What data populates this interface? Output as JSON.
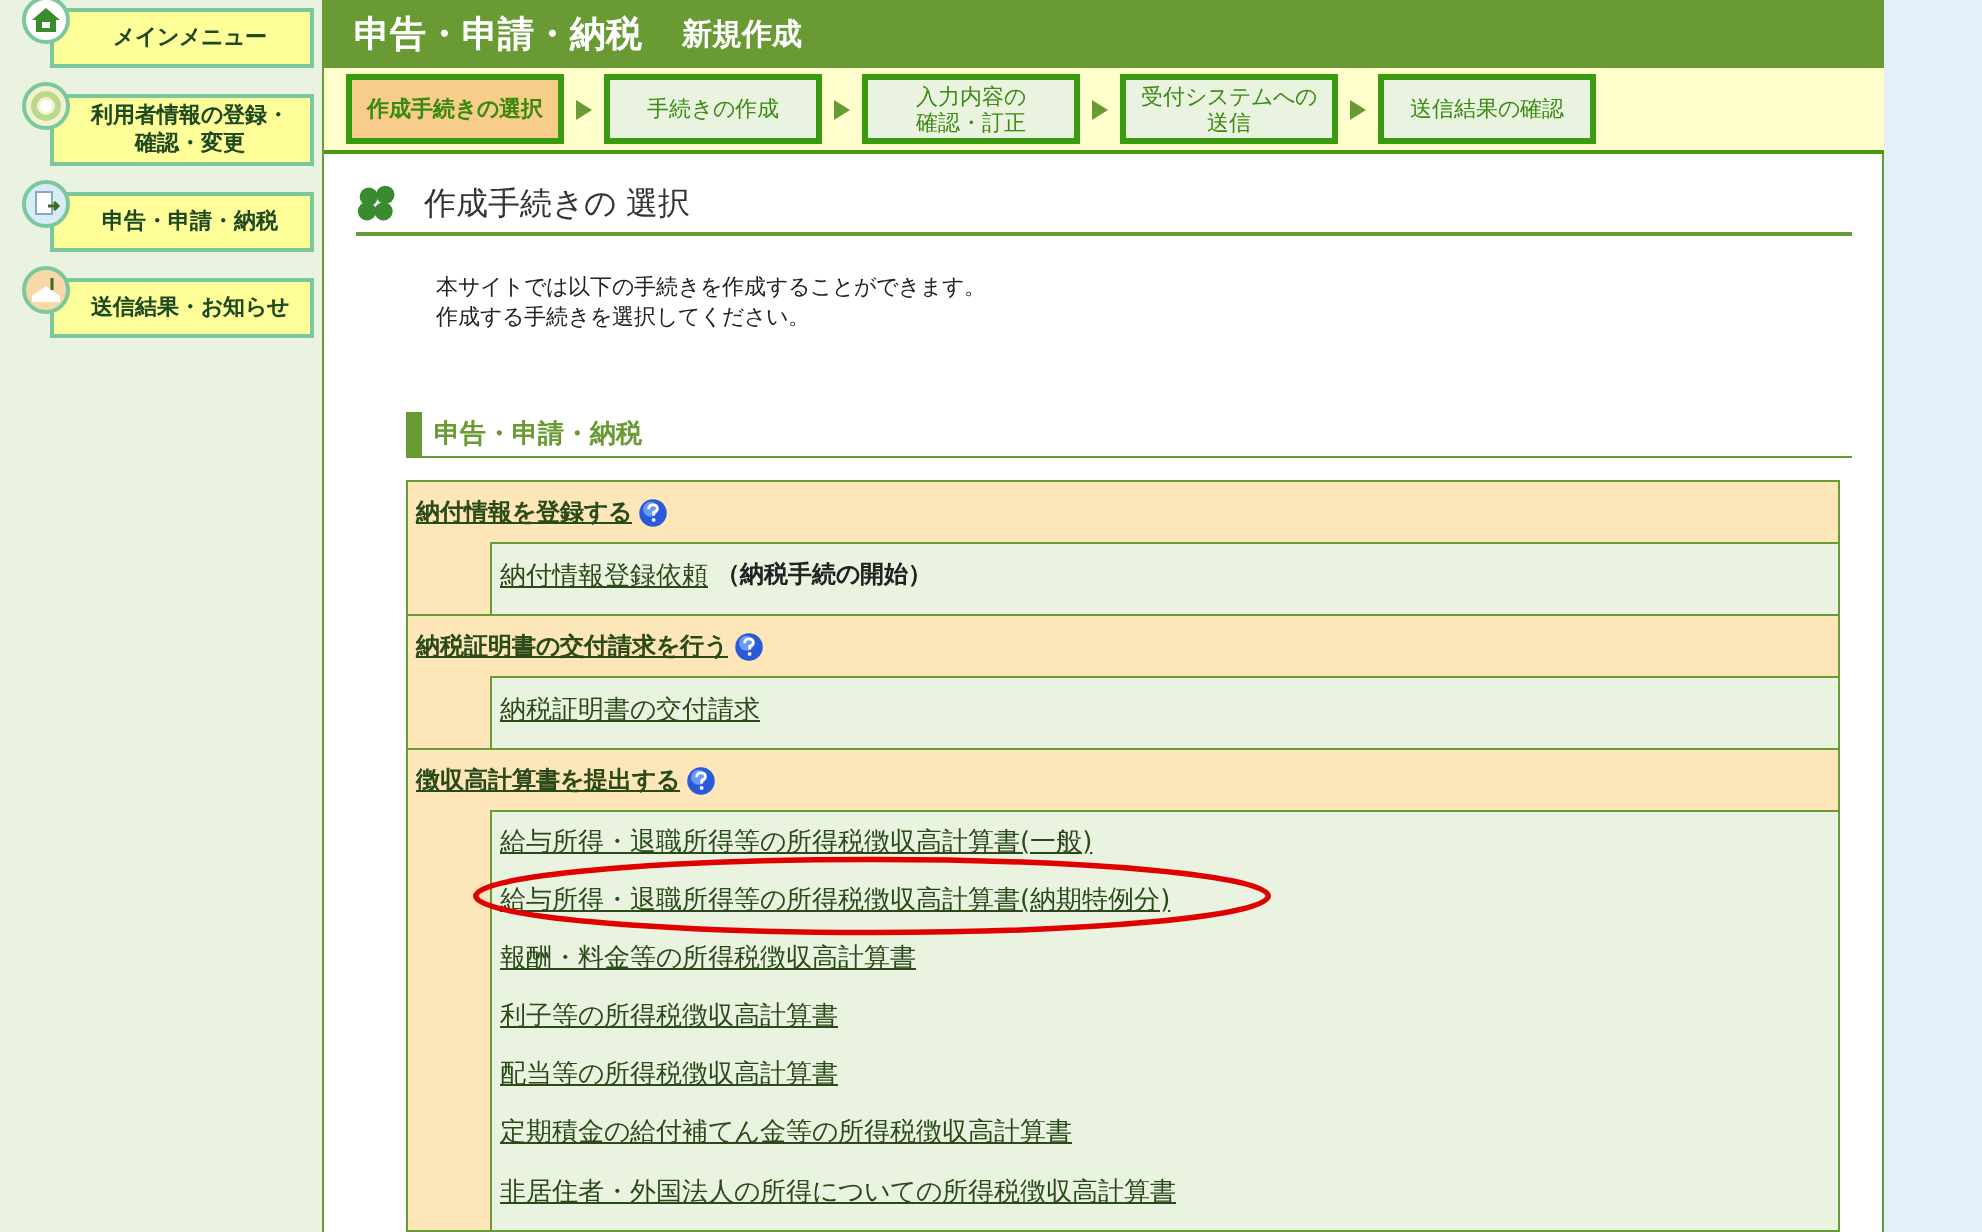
{
  "sidebar": {
    "items": [
      {
        "lines": [
          "メインメニュー"
        ],
        "kind": "home"
      },
      {
        "lines": [
          "利用者情報の登録・",
          "確認・変更"
        ],
        "kind": "user"
      },
      {
        "lines": [
          "申告・申請・納税"
        ],
        "kind": "document"
      },
      {
        "lines": [
          "送信結果・お知らせ"
        ],
        "kind": "mail"
      }
    ]
  },
  "header": {
    "title": "申告・申請・納税",
    "subtitle": "新規作成"
  },
  "steps": [
    {
      "lines": [
        "作成手続きの選択"
      ],
      "selected": true
    },
    {
      "lines": [
        "手続きの作成"
      ],
      "selected": false
    },
    {
      "lines": [
        "入力内容の",
        "確認・訂正"
      ],
      "selected": false
    },
    {
      "lines": [
        "受付システムへの",
        "送信"
      ],
      "selected": false
    },
    {
      "lines": [
        "送信結果の確認"
      ],
      "selected": false
    }
  ],
  "page_heading": "作成手続きの 選択",
  "intro": [
    "本サイトでは以下の手続きを作成することができます。",
    "作成する手続きを選択してください。"
  ],
  "section_title": "申告・申請・納税",
  "groups": [
    {
      "title": "納付情報を登録する",
      "items": [
        {
          "label": "納付情報登録依頼",
          "note": "（納税手続の開始）",
          "circled": false
        }
      ]
    },
    {
      "title": "納税証明書の交付請求を行う",
      "items": [
        {
          "label": "納税証明書の交付請求",
          "circled": false
        }
      ]
    },
    {
      "title": "徴収高計算書を提出する",
      "items": [
        {
          "label": "給与所得・退職所得等の所得税徴収高計算書(一般)",
          "circled": false
        },
        {
          "label": "給与所得・退職所得等の所得税徴収高計算書(納期特例分)",
          "circled": true
        },
        {
          "label": "報酬・料金等の所得税徴収高計算書",
          "circled": false
        },
        {
          "label": "利子等の所得税徴収高計算書",
          "circled": false
        },
        {
          "label": "配当等の所得税徴収高計算書",
          "circled": false
        },
        {
          "label": "定期積金の給付補てん金等の所得税徴収高計算書",
          "circled": false
        },
        {
          "label": "非居住者・外国法人の所得についての所得税徴収高計算書",
          "circled": false
        }
      ]
    }
  ]
}
